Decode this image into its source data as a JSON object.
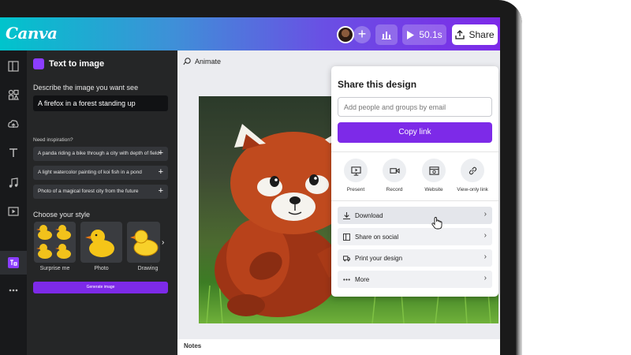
{
  "app": {
    "logo": "Canva"
  },
  "topbar": {
    "play_time": "50.1s",
    "share_label": "Share",
    "plus": "+"
  },
  "panel": {
    "title": "Text to image",
    "describe_label": "Describe the image you want see",
    "prompt_value": "A firefox in a forest standing up",
    "inspiration_label": "Need inspiration?",
    "suggestions": [
      "A panda riding a bike through a city with depth of field",
      "A light watercolor painting of koi fish in a pond",
      "Photo of a magical forest city from the future"
    ],
    "style_label": "Choose your style",
    "styles": [
      "Surprise me",
      "Photo",
      "Drawing"
    ],
    "generate_label": "Generate image"
  },
  "canvas": {
    "animate_label": "Animate",
    "notes_label": "Notes"
  },
  "share": {
    "title": "Share this design",
    "input_placeholder": "Add people and groups by email",
    "copy_label": "Copy link",
    "options": [
      "Present",
      "Record",
      "Website",
      "View-only link"
    ],
    "rows": [
      "Download",
      "Share on social",
      "Print your design",
      "More"
    ]
  },
  "colors": {
    "accent": "#7d2ae8",
    "teal": "#00c4cc"
  }
}
